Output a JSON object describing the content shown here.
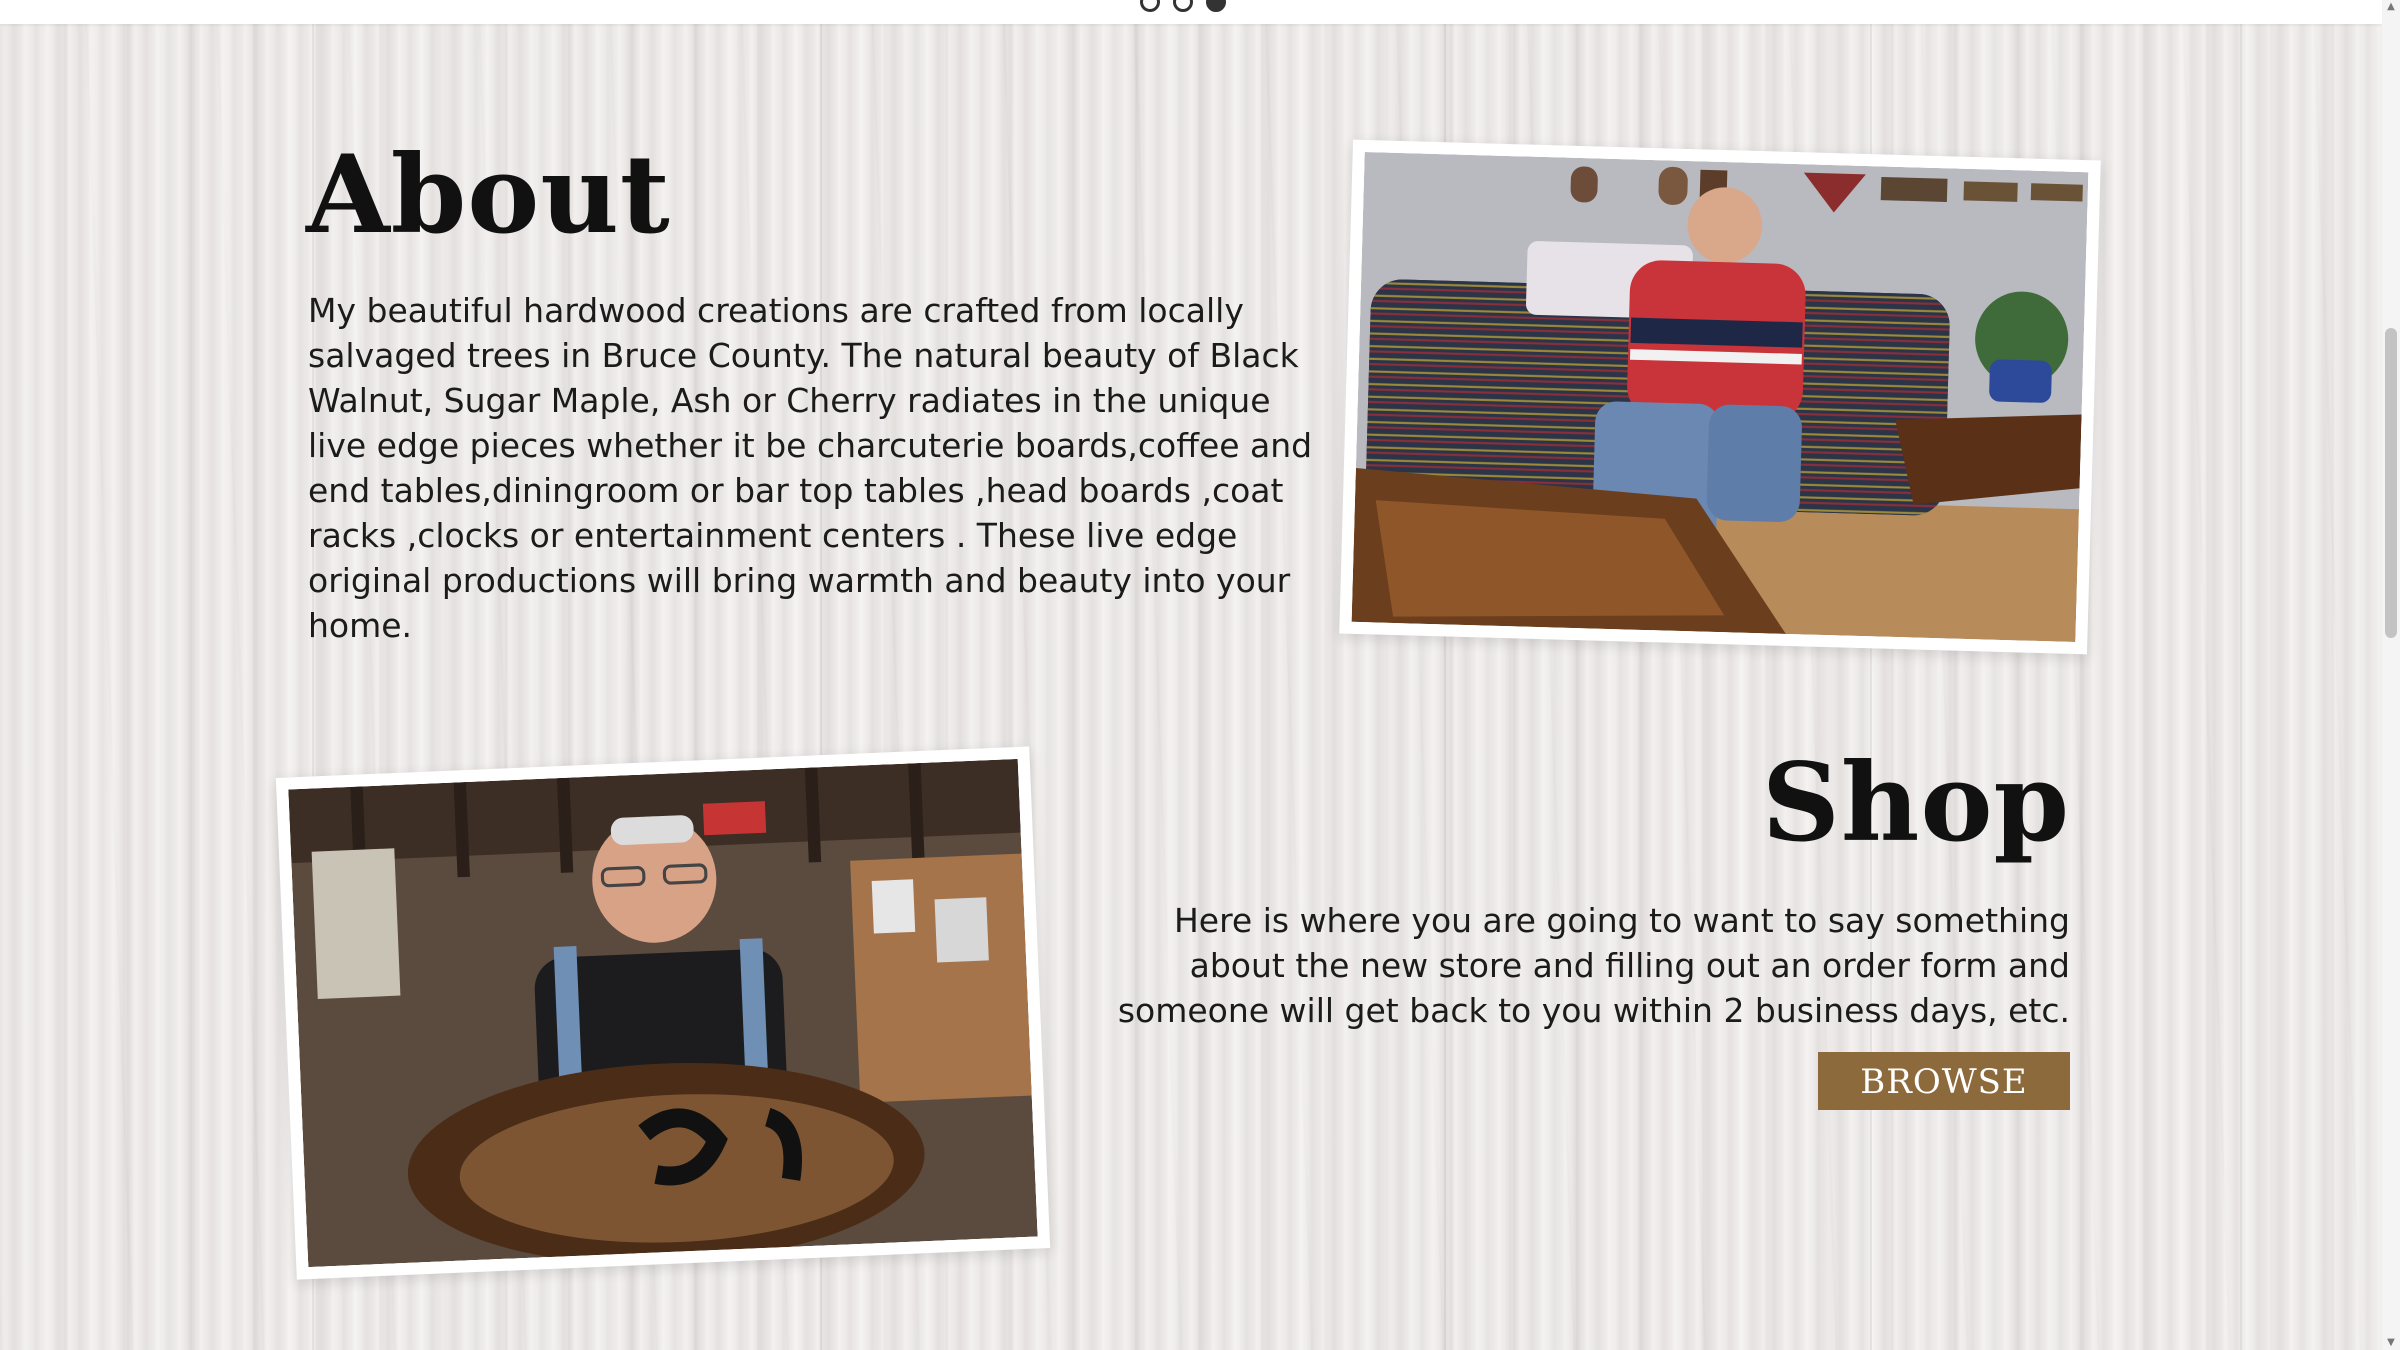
{
  "carousel": {
    "dots": 3,
    "active_index": 2
  },
  "about": {
    "heading": "About",
    "body": "My beautiful hardwood creations are crafted from locally salvaged trees in Bruce County. The natural beauty of Black Walnut, Sugar Maple, Ash or Cherry radiates in the unique live edge pieces whether it be charcuterie boards,coffee and end tables,diningroom or bar top tables ,head boards ,coat racks ,clocks or entertainment centers . These live edge original productions will bring warmth and beauty into your home."
  },
  "shop": {
    "heading": "Shop",
    "body": "Here is where you are going to want to say something about the new store and filling out an order form and someone will get back to you within 2 business days, etc.",
    "button_label": "BROWSE"
  },
  "photos": {
    "about_photo": "man seated on patterned sofa beside live-edge wood table",
    "shop_photo": "man in workshop holding live-edge wood house-number sign"
  },
  "colors": {
    "button_bg": "#8c6a3c",
    "heading_text": "#111111",
    "background": "#ebe7e6"
  }
}
